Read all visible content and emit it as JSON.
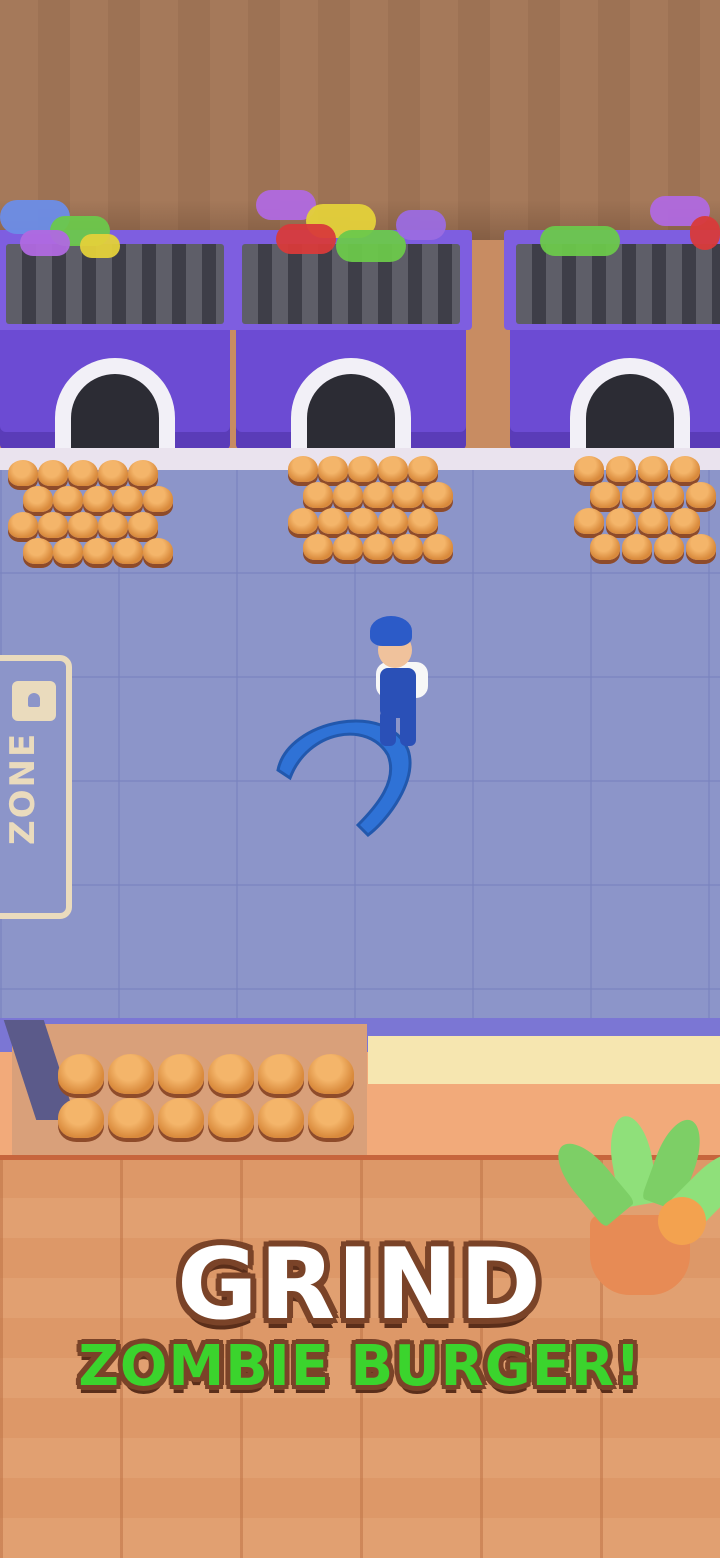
{
  "banner": {
    "title": "GRIND",
    "subtitle": "ZOMBIE BURGER!"
  },
  "zone_sign": {
    "label": "ZONE",
    "icon": "lock-icon"
  },
  "colors": {
    "floor": "#8c95c9",
    "grinder": "#6c4bd3",
    "title_text": "#ffffff",
    "subtitle_text": "#3bd42d",
    "text_outline": "#7a4328",
    "tool": "#2f72d6"
  },
  "scene": {
    "grinders": [
      "grinder-1",
      "grinder-2",
      "grinder-3"
    ],
    "character": "worker",
    "held_tool": "grinder-claw"
  }
}
